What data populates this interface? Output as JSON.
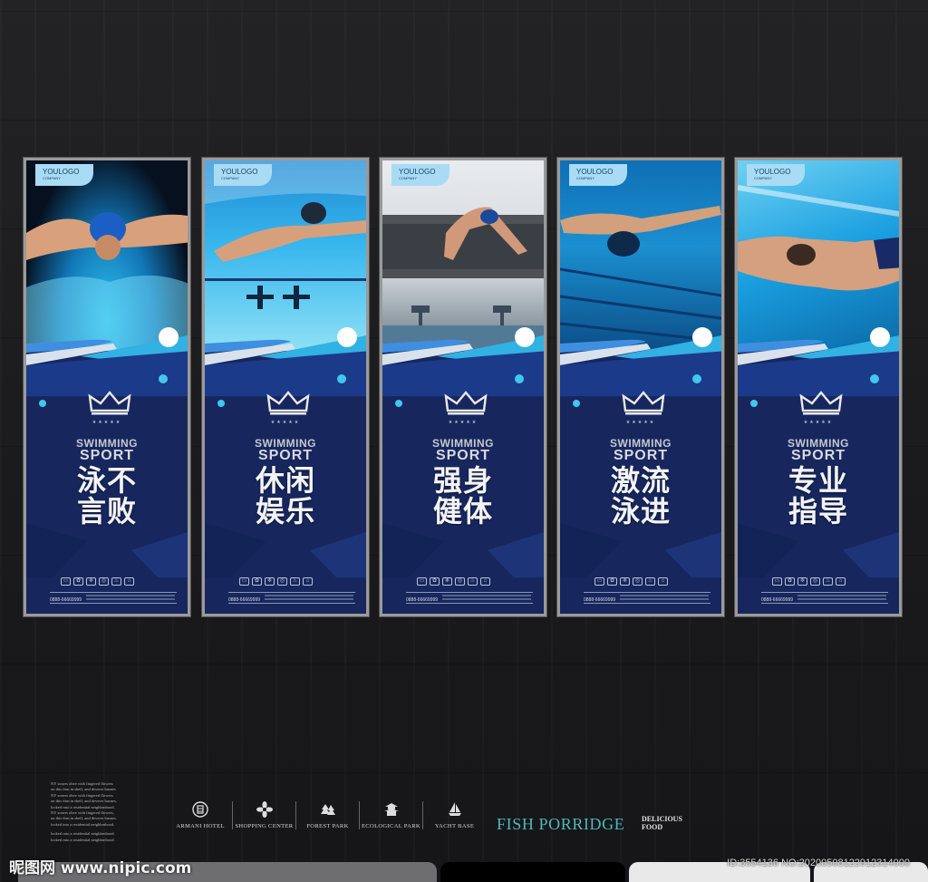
{
  "posters": [
    {
      "logo": "YOULOGO",
      "company": "COMPANY",
      "line1": "SWIMMING",
      "line2": "SPORT",
      "cn_line1": "泳不",
      "cn_line2": "言败",
      "phone": "0888-66669999"
    },
    {
      "logo": "YOULOGO",
      "company": "COMPANY",
      "line1": "SWIMMING",
      "line2": "SPORT",
      "cn_line1": "休闲",
      "cn_line2": "娱乐",
      "phone": "0888-66669999"
    },
    {
      "logo": "YOULOGO",
      "company": "COMPANY",
      "line1": "SWIMMING",
      "line2": "SPORT",
      "cn_line1": "强身",
      "cn_line2": "健体",
      "phone": "0888-66669999"
    },
    {
      "logo": "YOULOGO",
      "company": "COMPANY",
      "line1": "SWIMMING",
      "line2": "SPORT",
      "cn_line1": "激流",
      "cn_line2": "泳进",
      "phone": "0888-66669999"
    },
    {
      "logo": "YOULOGO",
      "company": "COMPANY",
      "line1": "SWIMMING",
      "line2": "SPORT",
      "cn_line1": "专业",
      "cn_line2": "指导",
      "phone": "0888-66669999"
    }
  ],
  "crown_stars": "★★★★★",
  "blurb": [
    "NY soners ohve with fingered flowers",
    "on this thrn in shelf, and deverer busnes",
    "NY soners ohve with fingered flowers",
    "on this thrn in shelf, and deverer busnes,",
    "locked rnto a residential neighbrnhood.",
    "NY soners ohve with fingered flowers,",
    "on this thrn in shelf, and deverer busnes.",
    "locked into a residential neighbrnhood.",
    "locked rnto a residential neighbrnhood.",
    "locked rnto a residential neighbrnhood."
  ],
  "brands": [
    {
      "name": "ARMANI HOTEL",
      "icon": "building-icon"
    },
    {
      "name": "SHOPPING CENTER",
      "icon": "flower-icon"
    },
    {
      "name": "FOREST PARK",
      "icon": "tree-icon"
    },
    {
      "name": "ECOLOGICAL PARK",
      "icon": "pagoda-icon"
    },
    {
      "name": "YACHT BASE",
      "icon": "sailboat-icon"
    }
  ],
  "fish_porridge": "FISH PORRIDGE",
  "delicious": "DELICIOUS",
  "food": "FOOD",
  "watermark": "昵图网 www.nipic.com",
  "image_id": "ID:3554136 NO:20200508122912314000",
  "colors": {
    "poster_bg": "#17275e",
    "accent_cyan": "#43c6ee",
    "fish_teal": "#4fb9bb"
  }
}
